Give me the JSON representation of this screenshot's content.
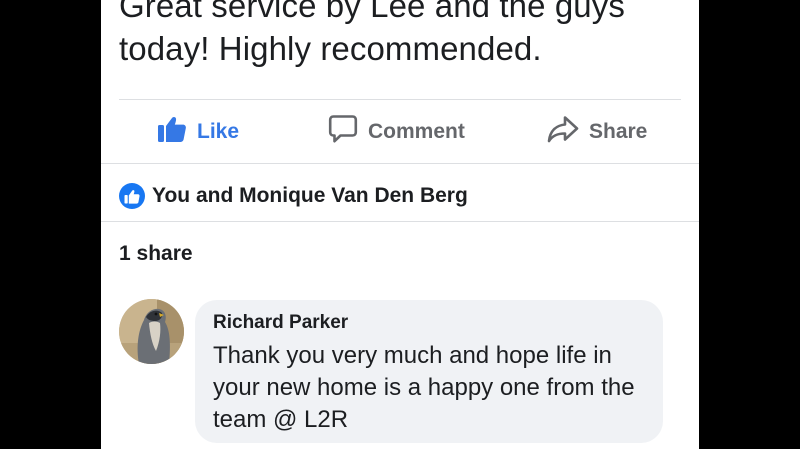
{
  "post": {
    "text": "Great service by Lee and the guys today! Highly recommended."
  },
  "actions": {
    "like_label": "Like",
    "comment_label": "Comment",
    "share_label": "Share"
  },
  "reactions": {
    "text": "You and Monique Van Den Berg"
  },
  "shares": {
    "text": "1 share"
  },
  "comment": {
    "author": "Richard Parker",
    "text": "Thank you very much and hope life in your new home is a happy one from the team @ L2R"
  },
  "colors": {
    "accent": "#3578e5",
    "like_badge": "#1877f2",
    "muted_text": "#65676b",
    "primary_text": "#1c1e21",
    "bubble": "#f0f2f5",
    "divider": "#dddfe2",
    "letterbox": "#000000"
  },
  "icons": {
    "like": "thumbs-up-icon",
    "comment": "speech-bubble-icon",
    "share": "share-arrow-icon",
    "reaction": "like-reaction-icon"
  }
}
